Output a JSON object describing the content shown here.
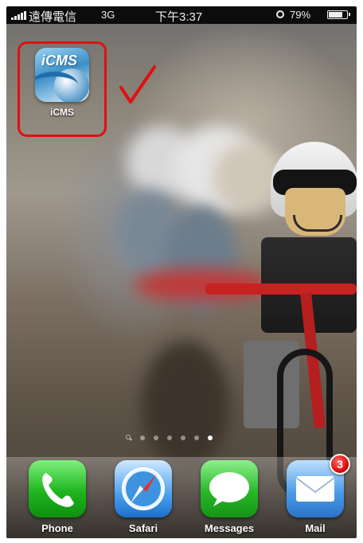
{
  "status_bar": {
    "carrier": "遠傳電信",
    "network": "3G",
    "time": "下午3:37",
    "battery_percent": "79%",
    "battery_level": 0.79,
    "icons": [
      "signal-bars-icon",
      "alarm-clock-icon",
      "battery-icon"
    ]
  },
  "home_screen": {
    "apps": [
      {
        "label": "iCMS",
        "icon": "icms-app-icon",
        "icon_text": "iCMS"
      }
    ],
    "annotation": {
      "icon": "red-checkmark-icon",
      "highlight_color": "#e01010"
    },
    "page_indicator": {
      "pages": 6,
      "current": 6,
      "has_spotlight": true
    }
  },
  "dock": {
    "apps": [
      {
        "label": "Phone",
        "icon": "phone-icon"
      },
      {
        "label": "Safari",
        "icon": "safari-compass-icon"
      },
      {
        "label": "Messages",
        "icon": "speech-bubble-icon"
      },
      {
        "label": "Mail",
        "icon": "envelope-icon",
        "badge": "3"
      }
    ]
  },
  "colors": {
    "badge": "#d40000",
    "highlight": "#e01010",
    "status_bar": "#0c0c0c"
  }
}
